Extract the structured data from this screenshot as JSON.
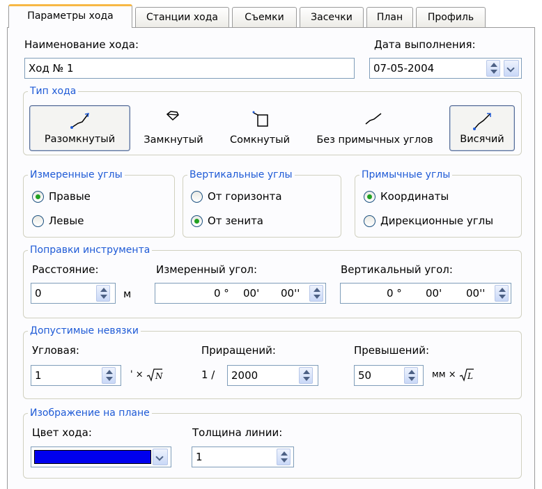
{
  "tabs": [
    {
      "label": "Параметры хода",
      "active": true
    },
    {
      "label": "Станции хода",
      "active": false
    },
    {
      "label": "Съемки",
      "active": false
    },
    {
      "label": "Засечки",
      "active": false
    },
    {
      "label": "План",
      "active": false
    },
    {
      "label": "Профиль",
      "active": false
    }
  ],
  "traverse_name": {
    "label": "Наименование хода:",
    "value": "Ход № 1"
  },
  "date": {
    "label": "Дата выполнения:",
    "value": "07-05-2004"
  },
  "traverse_type": {
    "legend": "Тип хода",
    "options": [
      {
        "label": "Разомкнутый",
        "icon": "open-traverse-icon",
        "pressed": true
      },
      {
        "label": "Замкнутый",
        "icon": "closed-traverse-icon",
        "pressed": false
      },
      {
        "label": "Сомкнутый",
        "icon": "connected-traverse-icon",
        "pressed": false
      },
      {
        "label": "Без примычных углов",
        "icon": "no-connection-angles-icon",
        "pressed": false
      },
      {
        "label": "Висячий",
        "icon": "hanging-traverse-icon",
        "pressed": true
      }
    ]
  },
  "measured_angles": {
    "legend": "Измеренные углы",
    "options": [
      "Правые",
      "Левые"
    ],
    "selected": "Правые"
  },
  "vertical_angles": {
    "legend": "Вертикальные углы",
    "options": [
      "От горизонта",
      "От зенита"
    ],
    "selected": "От зенита"
  },
  "connection_angles": {
    "legend": "Примычные углы",
    "options": [
      "Координаты",
      "Дирекционные углы"
    ],
    "selected": "Координаты"
  },
  "instrument_corrections": {
    "legend": "Поправки инструмента",
    "distance": {
      "label": "Расстояние:",
      "value": "0",
      "unit": "м"
    },
    "measured_angle": {
      "label": "Измеренный угол:",
      "deg": "0 °",
      "min": "00'",
      "sec": "00''"
    },
    "vertical_angle": {
      "label": "Вертикальный угол:",
      "deg": "0 °",
      "min": "00'",
      "sec": "00''"
    }
  },
  "tolerances": {
    "legend": "Допустимые невязки",
    "angular": {
      "label": "Угловая:",
      "value": "1",
      "unit_prefix": "' ×"
    },
    "increments": {
      "label": "Приращений:",
      "prefix": "1 /",
      "value": "2000"
    },
    "elevations": {
      "label": "Превышений:",
      "value": "50",
      "unit_prefix": "мм ×"
    }
  },
  "plan_display": {
    "legend": "Изображение на плане",
    "color": {
      "label": "Цвет хода:",
      "value": "#0000ee"
    },
    "line_width": {
      "label": "Толщина линии:",
      "value": "1"
    }
  },
  "colors": {
    "accent_tab": "#f7b845",
    "legend_text": "#1e5ad6",
    "radio_dot": "#21a121"
  }
}
